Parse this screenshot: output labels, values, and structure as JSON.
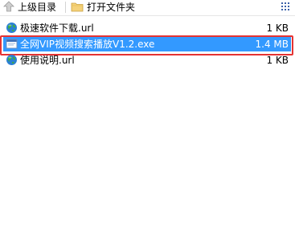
{
  "toolbar": {
    "up_label": "上级目录",
    "open_folder_label": "打开文件夹"
  },
  "files": [
    {
      "name": "极速软件下载.url",
      "size": "1 KB",
      "icon": "internet-shortcut-icon",
      "selected": false
    },
    {
      "name": "全网VIP视频搜索播放V1.2.exe",
      "size": "1.4 MB",
      "icon": "application-exe-icon",
      "selected": true
    },
    {
      "name": "使用说明.url",
      "size": "1 KB",
      "icon": "internet-shortcut-icon",
      "selected": false
    }
  ],
  "colors": {
    "selection": "#3399ff",
    "highlight_border": "#e53333"
  }
}
